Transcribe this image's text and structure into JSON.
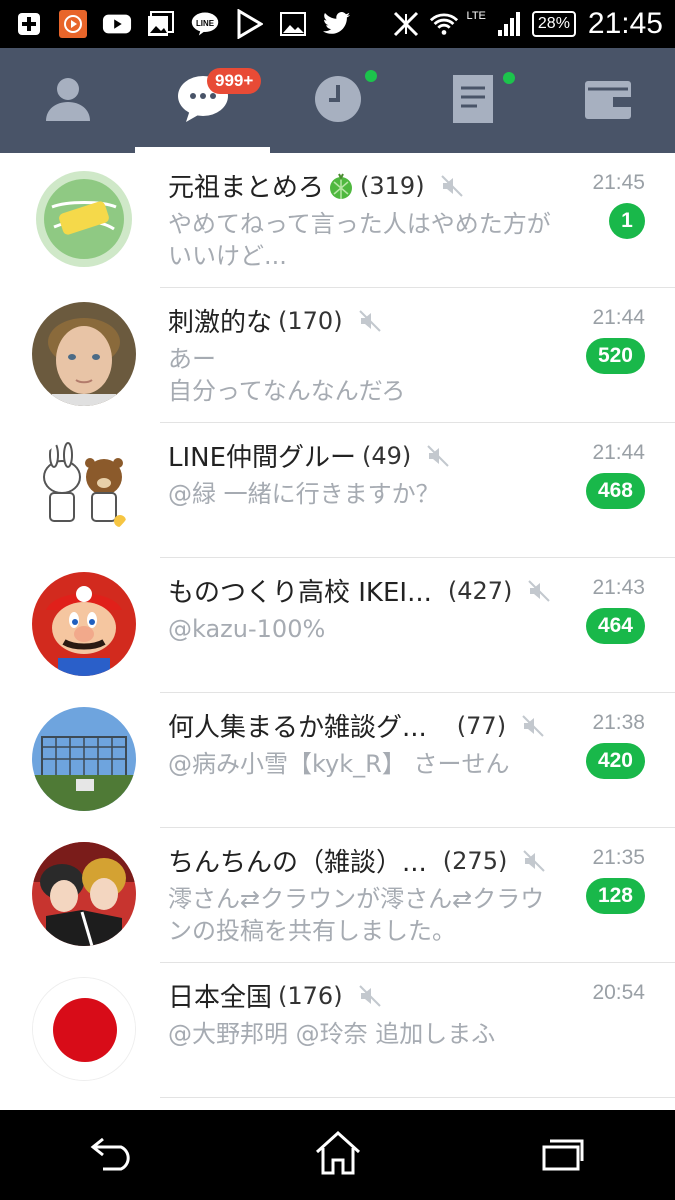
{
  "status_bar": {
    "time": "21:45",
    "battery": "28%",
    "network": "LTE",
    "icons": [
      "add-icon",
      "video-app-icon",
      "youtube-icon",
      "gallery-icon",
      "line-icon",
      "play-store-icon",
      "image-icon",
      "twitter-icon",
      "signal-off-icon",
      "wifi-icon",
      "cell-signal-icon"
    ]
  },
  "tabs": [
    {
      "name": "friends",
      "icon": "person-icon"
    },
    {
      "name": "chats",
      "icon": "chat-bubble-icon",
      "badge": "999+",
      "active": true
    },
    {
      "name": "timeline",
      "icon": "clock-icon",
      "dot": true
    },
    {
      "name": "news",
      "icon": "document-icon",
      "dot": true
    },
    {
      "name": "more",
      "icon": "wallet-icon"
    }
  ],
  "chats": [
    {
      "title": "元祖まとめろ",
      "count": "(319)",
      "time": "21:45",
      "preview": "やめてねって言った人はやめた方がいいけど...",
      "unread": "1",
      "muted": true,
      "melon": true
    },
    {
      "title": "刺激的な",
      "count": "(170)",
      "time": "21:44",
      "preview": "あー\n自分ってなんなんだろ",
      "unread": "520",
      "muted": true
    },
    {
      "title": "LINE仲間グルー",
      "count": "(49)",
      "time": "21:44",
      "preview": "@緑 一緒に行きますか？",
      "unread": "468",
      "muted": true
    },
    {
      "title": "ものつくり高校 IKEI...",
      "count": "(427)",
      "time": "21:43",
      "preview": "@kazu-100%",
      "unread": "464",
      "muted": true
    },
    {
      "title": "何人集まるか雑談グ...",
      "count": "(77)",
      "time": "21:38",
      "preview": "@病み小雪【kyk_R】 さーせん",
      "unread": "420",
      "muted": true
    },
    {
      "title": "ちんちんの（雑談）...",
      "count": "(275)",
      "time": "21:35",
      "preview": "澪さん⇄クラウンが澪さん⇄クラウンの投稿を共有しました。",
      "unread": "128",
      "muted": true
    },
    {
      "title": "日本全国",
      "count": "(176)",
      "time": "20:54",
      "preview": "@大野邦明 @玲奈 追加しまふ",
      "unread": "",
      "muted": true
    }
  ],
  "nav": {
    "back": "back-icon",
    "home": "home-icon",
    "recents": "recents-icon"
  }
}
